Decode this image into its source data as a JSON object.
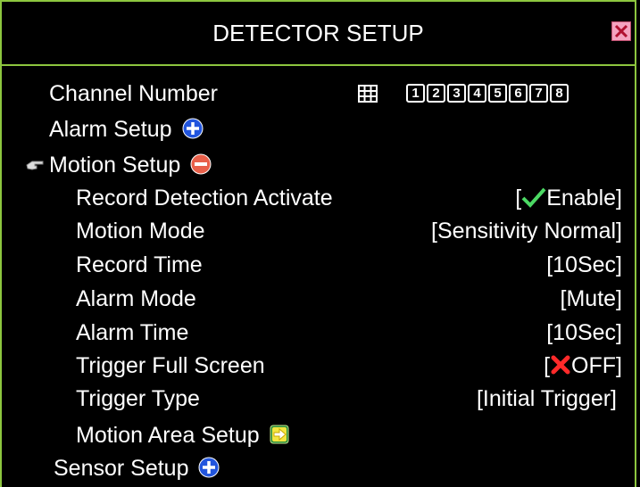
{
  "window": {
    "title": "DETECTOR SETUP"
  },
  "channel": {
    "label": "Channel Number",
    "numbers": [
      "1",
      "2",
      "3",
      "4",
      "5",
      "6",
      "7",
      "8"
    ]
  },
  "sections": {
    "alarm_setup": "Alarm Setup",
    "motion_setup": "Motion Setup",
    "sensor_setup": "Sensor Setup",
    "motion_area_setup": "Motion Area Setup"
  },
  "settings": {
    "record_detection": {
      "label": "Record Detection Activate",
      "value": "Enable",
      "open": "[",
      "close": "]"
    },
    "motion_mode": {
      "label": "Motion Mode",
      "value": "[Sensitivity Normal]"
    },
    "record_time": {
      "label": "Record Time",
      "value": "[10Sec]"
    },
    "alarm_mode": {
      "label": "Alarm Mode",
      "value": "[Mute]"
    },
    "alarm_time": {
      "label": "Alarm Time",
      "value": "[10Sec]"
    },
    "trigger_full_screen": {
      "label": "Trigger Full Screen",
      "value": "OFF",
      "open": "[",
      "close": "]"
    },
    "trigger_type": {
      "label": "Trigger Type",
      "value": "[Initial Trigger]"
    }
  },
  "colors": {
    "border": "#8dc63f",
    "background": "#000000",
    "text": "#ffffff",
    "plus_blue": "#2255dd",
    "minus_red": "#e8604a",
    "check_green": "#4cd964",
    "cross_red": "#ff2a2a"
  }
}
